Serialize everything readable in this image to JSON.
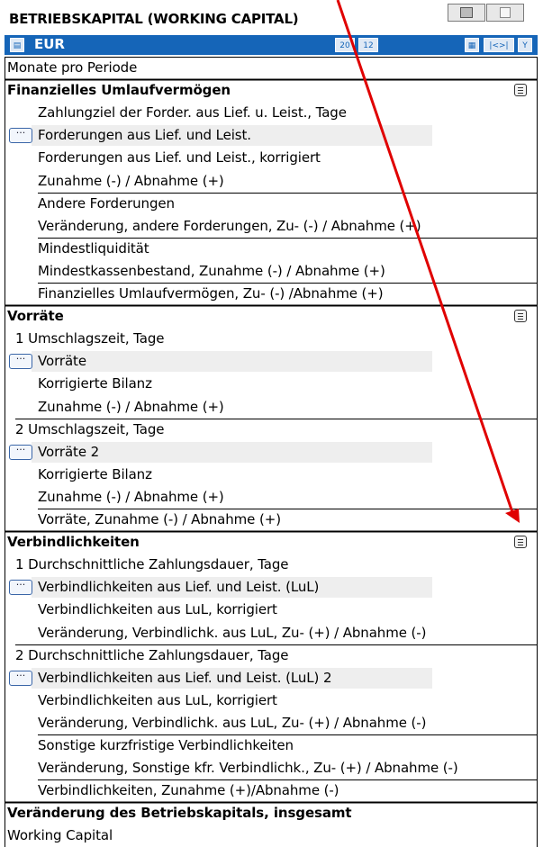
{
  "title": "BETRIEBSKAPITAL (WORKING CAPITAL)",
  "header": {
    "currency": "EUR",
    "icons": [
      "table-icon",
      "calendar-icon",
      "date-icon",
      "view-icon",
      "navigate-icon",
      "filter-icon"
    ]
  },
  "rows": [
    {
      "label": "Monate pro Periode",
      "kind": "plain"
    },
    {
      "label": "Finanzielles Umlaufvermögen",
      "kind": "section"
    },
    {
      "label": "Zahlungziel der Forder. aus Lief. u. Leist., Tage",
      "kind": "item"
    },
    {
      "label": "Forderungen aus Lief. und Leist.",
      "kind": "dots"
    },
    {
      "label": "Forderungen aus Lief. und Leist., korrigiert",
      "kind": "item"
    },
    {
      "label": "Zunahme (-) / Abnahme (+)",
      "kind": "item"
    },
    {
      "label": "Andere Forderungen",
      "kind": "item"
    },
    {
      "label": "Veränderung, andere Forderungen, Zu- (-) / Abnahme (+)",
      "kind": "item"
    },
    {
      "label": "Mindestliquidität",
      "kind": "item"
    },
    {
      "label": "Mindestkassenbestand, Zunahme (-) / Abnahme (+)",
      "kind": "item"
    },
    {
      "label": "Finanzielles Umlaufvermögen, Zu- (-) /Abnahme (+)",
      "kind": "item"
    },
    {
      "label": "Vorräte",
      "kind": "section"
    },
    {
      "label": "1 Umschlagszeit,  Tage",
      "kind": "numbered"
    },
    {
      "label": "Vorräte",
      "kind": "dots"
    },
    {
      "label": "Korrigierte Bilanz",
      "kind": "item"
    },
    {
      "label": "Zunahme (-) / Abnahme (+)",
      "kind": "item"
    },
    {
      "label": "2 Umschlagszeit,  Tage",
      "kind": "numbered"
    },
    {
      "label": "Vorräte 2",
      "kind": "dots"
    },
    {
      "label": "Korrigierte Bilanz",
      "kind": "item"
    },
    {
      "label": "Zunahme (-) / Abnahme (+)",
      "kind": "item"
    },
    {
      "label": "Vorräte, Zunahme (-) / Abnahme (+)",
      "kind": "item"
    },
    {
      "label": "Verbindlichkeiten",
      "kind": "section"
    },
    {
      "label": "1 Durchschnittliche Zahlungsdauer, Tage",
      "kind": "numbered"
    },
    {
      "label": "Verbindlichkeiten aus Lief. und Leist. (LuL)",
      "kind": "dots"
    },
    {
      "label": "Verbindlichkeiten aus LuL, korrigiert",
      "kind": "item"
    },
    {
      "label": "Veränderung, Verbindlichk. aus LuL, Zu- (+) / Abnahme (-)",
      "kind": "item"
    },
    {
      "label": "2 Durchschnittliche Zahlungsdauer, Tage",
      "kind": "numbered"
    },
    {
      "label": "Verbindlichkeiten aus Lief. und Leist. (LuL) 2",
      "kind": "dots"
    },
    {
      "label": "Verbindlichkeiten aus LuL, korrigiert",
      "kind": "item"
    },
    {
      "label": "Veränderung, Verbindlichk. aus LuL, Zu- (+) / Abnahme (-)",
      "kind": "item"
    },
    {
      "label": "Sonstige kurzfristige Verbindlichkeiten",
      "kind": "item"
    },
    {
      "label": "Veränderung, Sonstige kfr. Verbindlichk., Zu- (+) / Abnahme (-)",
      "kind": "item"
    },
    {
      "label": "Verbindlichkeiten, Zunahme (+)/Abnahme (-)",
      "kind": "item"
    },
    {
      "label": "Veränderung des Betriebskapitals, insgesamt",
      "kind": "section"
    },
    {
      "label": "Working Capital",
      "kind": "plain"
    }
  ],
  "colors": {
    "header_blue": "#1565b8",
    "arrow_red": "#e00000",
    "shade": "#eeeeee"
  }
}
